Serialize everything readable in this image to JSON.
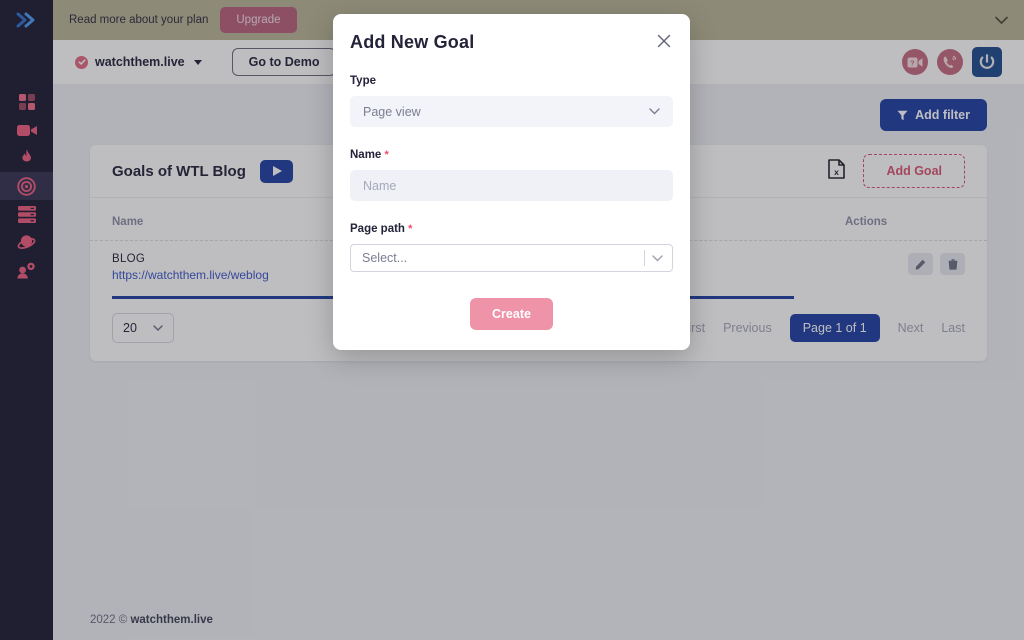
{
  "banner": {
    "text": "Read more about your plan",
    "upgrade_label": "Upgrade",
    "collapse_icon": "chevron-down-icon",
    "bg_color": "#b9b795"
  },
  "sidebar": {
    "logo_icon": "double-chevron-right-icon",
    "items": [
      {
        "icon": "dashboard-grid-icon",
        "active": false
      },
      {
        "icon": "video-camera-icon",
        "active": false
      },
      {
        "icon": "flame-icon",
        "active": false
      },
      {
        "icon": "target-goal-icon",
        "active": true
      },
      {
        "icon": "server-stack-icon",
        "active": false
      },
      {
        "icon": "planet-orbit-icon",
        "active": false
      },
      {
        "icon": "user-settings-icon",
        "active": false
      }
    ],
    "bg_color": "#1d1b31",
    "icon_color": "#ef5d7e"
  },
  "header": {
    "site_name": "watchthem.live",
    "site_verified_icon": "check-circle-icon",
    "site_dropdown_icon": "caret-down-icon",
    "demo_button": "Go to Demo",
    "icons": [
      {
        "name": "video-help-icon"
      },
      {
        "name": "phone-support-icon"
      },
      {
        "name": "power-logout-icon"
      }
    ]
  },
  "content": {
    "add_filter_label": "Add filter",
    "add_filter_icon": "filter-funnel-icon",
    "card_title": "Goals of WTL Blog",
    "play_icon": "play-icon",
    "export_icon": "excel-export-icon",
    "add_goal_label": "Add Goal",
    "table": {
      "columns": [
        "Name",
        "Actions"
      ],
      "rows": [
        {
          "name_label": "BLOG",
          "name_link": "https://watchthem.live/weblog",
          "edit_icon": "pencil-edit-icon",
          "delete_icon": "trash-delete-icon"
        }
      ],
      "progress_percent": 80
    },
    "per_page_value": "20",
    "per_page_icon": "chevron-down-icon",
    "pagination": {
      "first": "First",
      "previous": "Previous",
      "current": "Page 1 of 1",
      "next": "Next",
      "last": "Last"
    }
  },
  "footer": {
    "year": "2022 ©",
    "brand": "watchthem.live"
  },
  "modal": {
    "title": "Add New Goal",
    "close_icon": "close-icon",
    "type": {
      "label": "Type",
      "value": "Page view",
      "chevron_icon": "chevron-down-icon"
    },
    "name": {
      "label": "Name",
      "required_mark": "*",
      "value": "",
      "placeholder": "Name"
    },
    "page_path": {
      "label": "Page path",
      "required_mark": "*",
      "value": "Select...",
      "chevron_icon": "chevron-down-icon"
    },
    "create_label": "Create",
    "create_color": "#ef93a8"
  }
}
